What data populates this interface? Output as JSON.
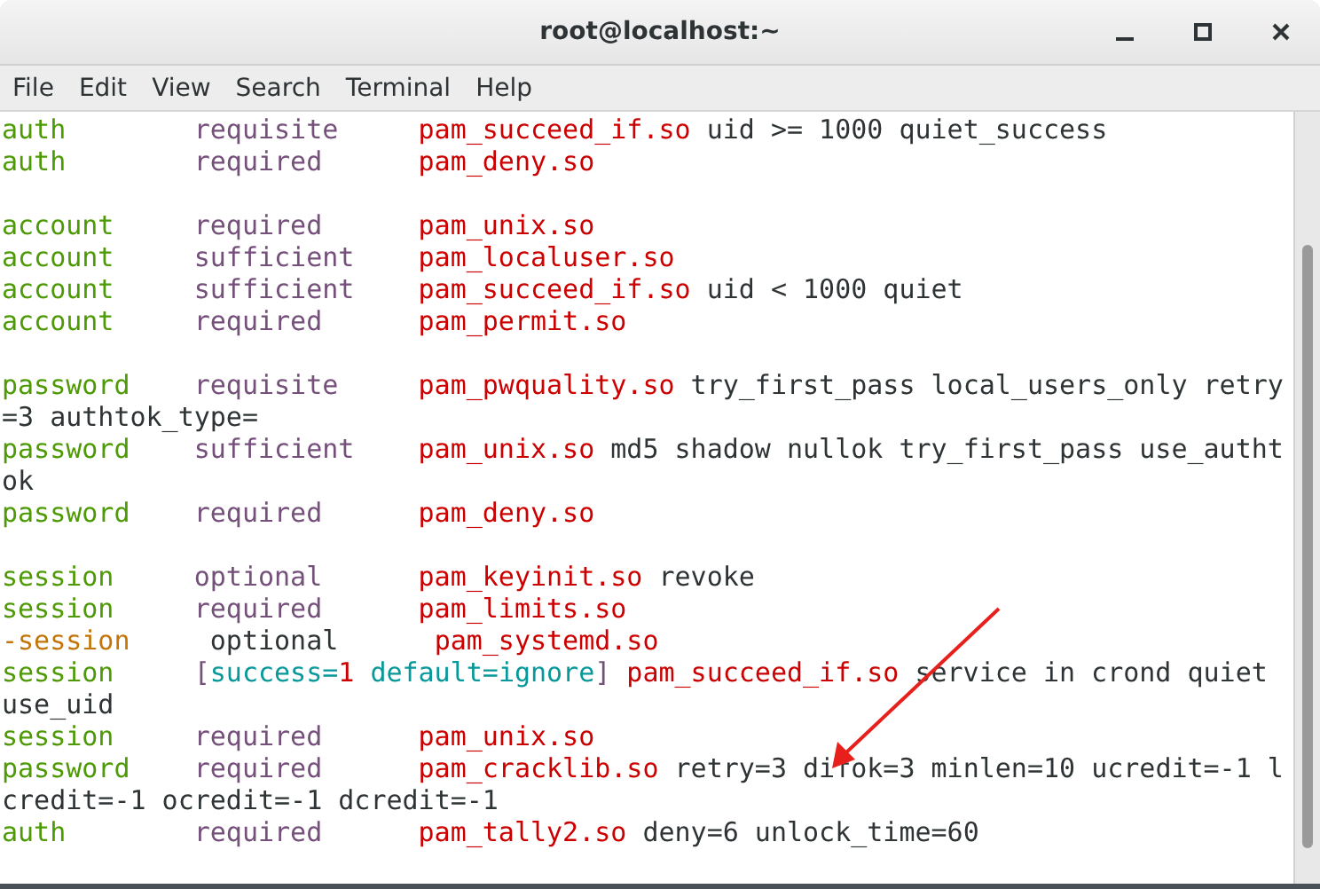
{
  "window": {
    "title": "root@localhost:~"
  },
  "menu": [
    "File",
    "Edit",
    "View",
    "Search",
    "Terminal",
    "Help"
  ],
  "lines": [
    {
      "kind": "entry",
      "type": "auth",
      "control": "requisite",
      "module": "pam_succeed_if.so",
      "args": "uid >= 1000 quiet_success"
    },
    {
      "kind": "entry",
      "type": "auth",
      "control": "required",
      "module": "pam_deny.so"
    },
    {
      "kind": "blank"
    },
    {
      "kind": "entry",
      "type": "account",
      "control": "required",
      "module": "pam_unix.so"
    },
    {
      "kind": "entry",
      "type": "account",
      "control": "sufficient",
      "module": "pam_localuser.so"
    },
    {
      "kind": "entry",
      "type": "account",
      "control": "sufficient",
      "module": "pam_succeed_if.so",
      "args": "uid < 1000 quiet"
    },
    {
      "kind": "entry",
      "type": "account",
      "control": "required",
      "module": "pam_permit.so"
    },
    {
      "kind": "blank"
    },
    {
      "kind": "entry",
      "type": "password",
      "control": "requisite",
      "module": "pam_pwquality.so",
      "args": "try_first_pass local_users_only retry"
    },
    {
      "kind": "wrap",
      "text": "=3 authtok_type="
    },
    {
      "kind": "entry",
      "type": "password",
      "control": "sufficient",
      "module": "pam_unix.so",
      "args": "md5 shadow nullok try_first_pass use_autht"
    },
    {
      "kind": "wrap",
      "text": "ok"
    },
    {
      "kind": "entry",
      "type": "password",
      "control": "required",
      "module": "pam_deny.so"
    },
    {
      "kind": "blank"
    },
    {
      "kind": "entry",
      "type": "session",
      "control": "optional",
      "module": "pam_keyinit.so",
      "args": "revoke"
    },
    {
      "kind": "entry",
      "type": "session",
      "control": "required",
      "module": "pam_limits.so"
    },
    {
      "kind": "optional-entry",
      "type": "-session",
      "control": "optional",
      "module": "pam_systemd.so"
    },
    {
      "kind": "bracket-entry",
      "type": "session",
      "control_tokens": [
        {
          "kind": "bracket",
          "text": "["
        },
        {
          "kind": "key",
          "text": "success"
        },
        {
          "kind": "key",
          "text": "="
        },
        {
          "kind": "num",
          "text": "1"
        },
        {
          "kind": "key",
          "text": "default",
          "space_before": true
        },
        {
          "kind": "key",
          "text": "="
        },
        {
          "kind": "key",
          "text": "ignore"
        },
        {
          "kind": "bracket",
          "text": "]"
        }
      ],
      "module": "pam_succeed_if.so",
      "args": "service in crond quiet"
    },
    {
      "kind": "wrap",
      "text": "use_uid"
    },
    {
      "kind": "entry",
      "type": "session",
      "control": "required",
      "module": "pam_unix.so"
    },
    {
      "kind": "entry",
      "type": "password",
      "control": "required",
      "module": "pam_cracklib.so",
      "args": "retry=3 difok=3 minlen=10 ucredit=-1 l"
    },
    {
      "kind": "wrap",
      "text": "credit=-1 ocredit=-1 dcredit=-1"
    },
    {
      "kind": "entry",
      "type": "auth",
      "control": "required",
      "module": "pam_tally2.so",
      "args": "deny=6 unlock_time=60"
    }
  ]
}
